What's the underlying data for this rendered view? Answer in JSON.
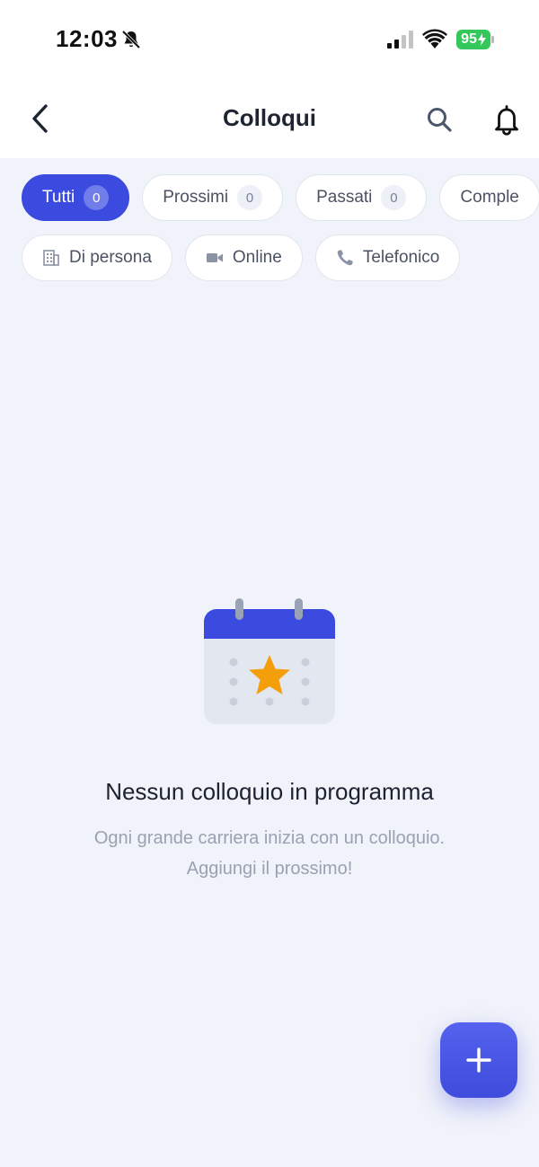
{
  "status_bar": {
    "time": "12:03",
    "battery_level": "95",
    "battery_color": "#34C759"
  },
  "header": {
    "title": "Colloqui",
    "back_icon": "chevron-left-icon",
    "search_icon": "search-icon",
    "notifications_icon": "bell-icon"
  },
  "filters": {
    "status_tabs": [
      {
        "label": "Tutti",
        "count": "0",
        "active": true
      },
      {
        "label": "Prossimi",
        "count": "0",
        "active": false
      },
      {
        "label": "Passati",
        "count": "0",
        "active": false
      },
      {
        "label": "Comple",
        "active": false
      }
    ],
    "type_tabs": [
      {
        "label": "Di persona",
        "icon": "building-icon"
      },
      {
        "label": "Online",
        "icon": "video-camera-icon"
      },
      {
        "label": "Telefonico",
        "icon": "phone-icon"
      }
    ]
  },
  "empty_state": {
    "illustration": "calendar-star-icon",
    "title": "Nessun colloquio in programma",
    "message_line1": "Ogni grande carriera inizia con un colloquio.",
    "message_line2": "Aggiungi il prossimo!"
  },
  "fab": {
    "icon": "plus-icon"
  },
  "colors": {
    "accent": "#3B4BDF",
    "background": "#F1F3FA",
    "star": "#F59E0B"
  }
}
